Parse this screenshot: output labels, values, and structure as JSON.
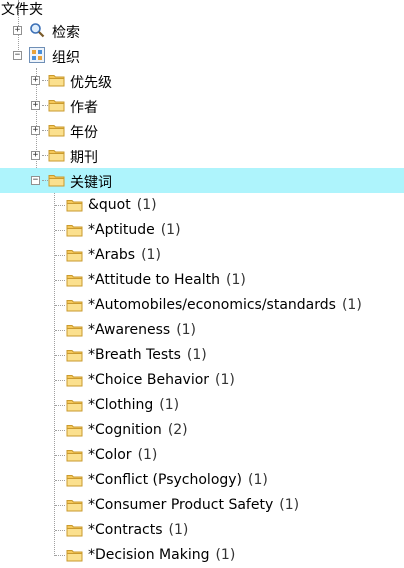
{
  "header": {
    "title": "文件夹"
  },
  "tree": {
    "search_label": "检索",
    "org_label": "组织",
    "categories": [
      {
        "label": "优先级",
        "toggle": "+"
      },
      {
        "label": "作者",
        "toggle": "+"
      },
      {
        "label": "年份",
        "toggle": "+"
      },
      {
        "label": "期刊",
        "toggle": "+"
      },
      {
        "label": "关键词",
        "toggle": "−",
        "selected": true
      }
    ],
    "keywords": [
      {
        "label": "&quot",
        "count": "(1)"
      },
      {
        "label": "*Aptitude",
        "count": "(1)"
      },
      {
        "label": "*Arabs",
        "count": "(1)"
      },
      {
        "label": "*Attitude to Health",
        "count": "(1)"
      },
      {
        "label": "*Automobiles/economics/standards",
        "count": "(1)"
      },
      {
        "label": "*Awareness",
        "count": "(1)"
      },
      {
        "label": "*Breath Tests",
        "count": "(1)"
      },
      {
        "label": "*Choice Behavior",
        "count": "(1)"
      },
      {
        "label": "*Clothing",
        "count": "(1)"
      },
      {
        "label": "*Cognition",
        "count": "(2)"
      },
      {
        "label": "*Color",
        "count": "(1)"
      },
      {
        "label": "*Conflict (Psychology)",
        "count": "(1)"
      },
      {
        "label": "*Consumer Product Safety",
        "count": "(1)"
      },
      {
        "label": "*Contracts",
        "count": "(1)"
      },
      {
        "label": "*Decision Making",
        "count": "(1)"
      }
    ]
  },
  "colors": {
    "selected_bg": "#aef4fc",
    "folder_fill": "#f6c85a",
    "folder_stroke": "#c99a2e"
  }
}
